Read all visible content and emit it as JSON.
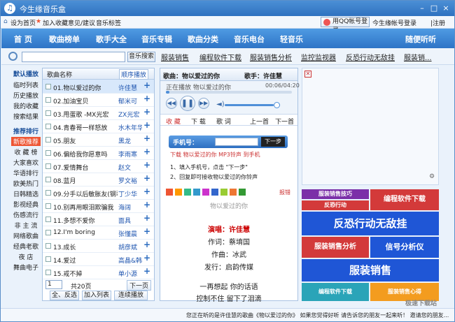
{
  "app": {
    "title": "今生缘音乐盒"
  },
  "window_controls": {
    "minimize": "–",
    "maximize": "□",
    "close": "×"
  },
  "topbar": {
    "set_home": "设为首页",
    "add_fav": "加入收藏",
    "feedback": "意见/建议",
    "tags": "音乐标签",
    "qq_login": "用QQ帐号登录",
    "account_login": "今生缘帐号登录",
    "register": "|注册"
  },
  "nav": {
    "items": [
      "首 页",
      "歌曲榜单",
      "歌手大全",
      "音乐专辑",
      "歌曲分类",
      "音乐电台",
      "轻音乐",
      "随便听听"
    ]
  },
  "search": {
    "placeholder": "",
    "button": "音乐搜索",
    "hot": [
      "服装销售",
      "编程软件下载",
      "服装销售分析",
      "监控监视器",
      "反恐行动无敌挂",
      "服装销..."
    ]
  },
  "left_menu": {
    "section1": "默认播放",
    "items1": [
      "临时列表",
      "历史播放",
      "我的收藏",
      "搜索结果"
    ],
    "section2": "推荐排行",
    "items2": [
      "新歌推荐",
      "收 藏 榜",
      "大家喜欢",
      "华语排行",
      "欧美热门",
      "日韩精选",
      "影视经典",
      "伤感流行",
      "非 主 流",
      "网络歌曲",
      "经典老歌",
      "夜 店",
      "舞曲电子"
    ]
  },
  "list": {
    "col_name": "歌曲名称",
    "col_sort": "顺序播放",
    "songs": [
      {
        "name": "01.物以爱过的你",
        "artist": "许佳慧"
      },
      {
        "name": "02.加油宝贝",
        "artist": "郁米可"
      },
      {
        "name": "03.甩蛋歌 -MX光宏",
        "artist": "ZX光宏"
      },
      {
        "name": "04.青春哥一样怒放",
        "artist": "水木年华"
      },
      {
        "name": "05.朋友",
        "artist": "黑龙"
      },
      {
        "name": "06.偏给我你愿意吗",
        "artist": "李雨寒"
      },
      {
        "name": "07.爱情舞台",
        "artist": "赵文"
      },
      {
        "name": "08.蓝月",
        "artist": "罗文裕"
      },
      {
        "name": "09.分手以后敏胀友(钢琴",
        "artist": "丁少华"
      },
      {
        "name": "10.别再用眼泪欺骗我",
        "artist": "海阔"
      },
      {
        "name": "11.多想不爱你",
        "artist": "面具"
      },
      {
        "name": "12.I'm boring",
        "artist": "张懂晨"
      },
      {
        "name": "13.成长",
        "artist": "胡彦斌"
      },
      {
        "name": "14.爱过",
        "artist": "高晶&韩"
      },
      {
        "name": "15.戒不掉",
        "artist": "单小源"
      }
    ],
    "page_value": "1",
    "total_pages": "共20页",
    "next_page": "下一页",
    "select_all": "全、反选",
    "add_list": "加入列表",
    "continuous": "连续播放"
  },
  "player": {
    "song_label": "歌曲：物以爱过的你",
    "singer_label": "歌手：许佳慧",
    "now_playing": "正在播放 物以爱过的你",
    "time": "00:06/04:20",
    "tabs": [
      "收 藏",
      "下 载",
      "歌 词",
      "上一首",
      "下一首"
    ],
    "phone_label": "手机号：",
    "next_step": "下一步",
    "download_text": "下载 物以爱过的你 MP3铃声 到手机",
    "step1": "1、填入手机号，点击 \"下一步\"",
    "step2": "2、回复即可接收物以爱过的你铃声",
    "report": "报错",
    "lyric_title": "物以爱过的你",
    "lyrics": [
      "演唱：许佳慧",
      "作词：蔡堉国",
      "作曲：冰武",
      "发行：启韵传媒",
      "一再想起 你的话语",
      "控制不住 留下了泪滴"
    ]
  },
  "ads": {
    "tiles": [
      "服装销售技巧",
      "编程软件下载",
      "反恐行动",
      "反恐行动无敌挂",
      "服装销售分析",
      "信号分析仪",
      "服装销售",
      "编程软件下载",
      "服装销售心得"
    ]
  },
  "status": {
    "text": "您正在听的是许佳慧的歌曲《物以爱过的你》 如果您觉得好听 请告诉您的朋友一起来听！ 邀请您的朋友...",
    "watermark": "极速下载站"
  },
  "colors": {
    "nav": "#2e74c6",
    "accent": "#e53322",
    "tile_red": "#d33a3a",
    "tile_purple": "#7b2fa8",
    "tile_blue": "#1f56d6",
    "tile_teal": "#2aa4b8",
    "tile_orange": "#f39c1f"
  }
}
